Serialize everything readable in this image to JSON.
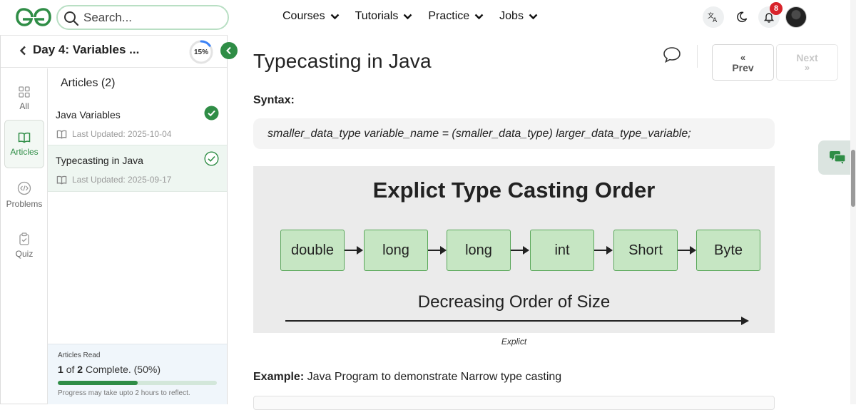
{
  "header": {
    "search_placeholder": "Search...",
    "nav": [
      {
        "label": "Courses"
      },
      {
        "label": "Tutorials"
      },
      {
        "label": "Practice"
      },
      {
        "label": "Jobs"
      }
    ],
    "notification_count": "8",
    "icons": {
      "logo": "geeksforgeeks-logo",
      "translate": "translate-icon",
      "theme": "moon-icon",
      "bell": "bell-icon"
    }
  },
  "sidebar": {
    "day_title": "Day 4: Variables ...",
    "progress_percent": "15%",
    "progress_value": 0.15,
    "tabs": [
      {
        "label": "All",
        "icon": "grid-icon"
      },
      {
        "label": "Articles",
        "icon": "book-icon"
      },
      {
        "label": "Problems",
        "icon": "code-icon"
      },
      {
        "label": "Quiz",
        "icon": "clipboard-icon"
      }
    ],
    "active_tab": "Articles",
    "articles_heading": "Articles (2)",
    "articles": [
      {
        "title": "Java Variables",
        "updated": "Last Updated: 2025-10-04",
        "status": "completed"
      },
      {
        "title": "Typecasting in Java",
        "updated": "Last Updated: 2025-09-17",
        "status": "in-progress"
      }
    ],
    "read_summary": {
      "label": "Articles Read",
      "read": "1",
      "of_word": "of",
      "total": "2",
      "complete_text": "Complete. (50%)",
      "progress_value": 0.5,
      "note": "Progress may take upto 2 hours to reflect."
    }
  },
  "article": {
    "title": "Typecasting in Java",
    "prev_label": "Prev",
    "next_label": "Next",
    "syntax_label": "Syntax:",
    "syntax_code": "smaller_data_type variable_name = (smaller_data_type) larger_data_type_variable;",
    "diagram": {
      "title": "Explict Type Casting Order",
      "boxes": [
        "double",
        "long",
        "long",
        "int",
        "Short",
        "Byte"
      ],
      "order_label": "Decreasing Order of Size",
      "caption": "Explict"
    },
    "example_label": "Example:",
    "example_text": "Java Program to demonstrate Narrow type casting"
  },
  "colors": {
    "brand": "#2f8d46",
    "badge": "#d8232a",
    "diagram_box": "#c6e6c3"
  }
}
